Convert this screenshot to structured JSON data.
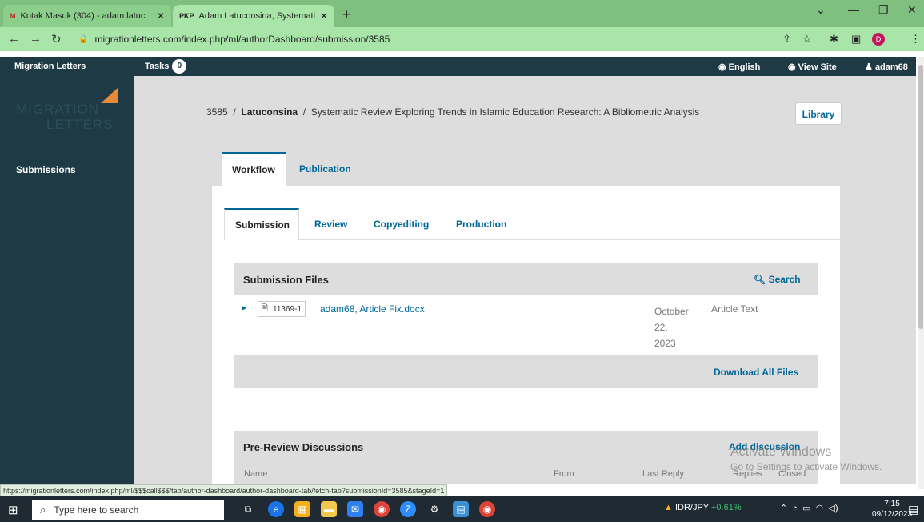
{
  "browser": {
    "tabs": [
      {
        "title": "Kotak Masuk (304) - adam.latuc",
        "favicon": "M"
      },
      {
        "title": "Adam Latuconsina, Systematic R",
        "favicon": "PKP"
      }
    ],
    "url": "migrationletters.com/index.php/ml/authorDashboard/submission/3585",
    "profile_initial": "D"
  },
  "ojs": {
    "site_name": "Migration Letters",
    "tasks_label": "Tasks",
    "tasks_count": "0",
    "language": "English",
    "view_site": "View Site",
    "username": "adam68",
    "logo_line1": "MIGRATION",
    "logo_line2": "LETTERS",
    "sidebar_submissions": "Submissions"
  },
  "breadcrumb": {
    "id": "3585",
    "sep": "/",
    "author": "Latuconsina",
    "title": "Systematic Review Exploring Trends in Islamic Education Research: A Bibliometric Analysis"
  },
  "library_label": "Library",
  "main_tabs": [
    "Workflow",
    "Publication"
  ],
  "stage_tabs": [
    "Submission",
    "Review",
    "Copyediting",
    "Production"
  ],
  "submission_files": {
    "title": "Submission Files",
    "search_label": "Search",
    "files": [
      {
        "id": "11369-1",
        "name": "adam68, Article Fix.docx",
        "date_line1": "October",
        "date_line2": "22,",
        "date_line3": "2023",
        "genre": "Article Text"
      }
    ],
    "download_all": "Download All Files"
  },
  "discussions": {
    "title": "Pre-Review Discussions",
    "add_label": "Add discussion",
    "columns": [
      "Name",
      "From",
      "Last Reply",
      "Replies",
      "Closed"
    ]
  },
  "watermark": {
    "line1": "Activate Windows",
    "line2": "Go to Settings to activate Windows."
  },
  "status_url": "https://migrationletters.com/index.php/ml/$$$call$$$/tab/author-dashboard/author-dashboard-tab/fetch-tab?submissionId=3585&stageId=1",
  "taskbar": {
    "search_placeholder": "Type here to search",
    "ticker_pair": "IDR/JPY",
    "ticker_change": "+0.61%",
    "time": "7:15",
    "date": "09/12/2023"
  },
  "colors": {
    "ojs_dark": "#1e3a44",
    "link_blue": "#006798",
    "tab_green": "#a9e4a9"
  }
}
